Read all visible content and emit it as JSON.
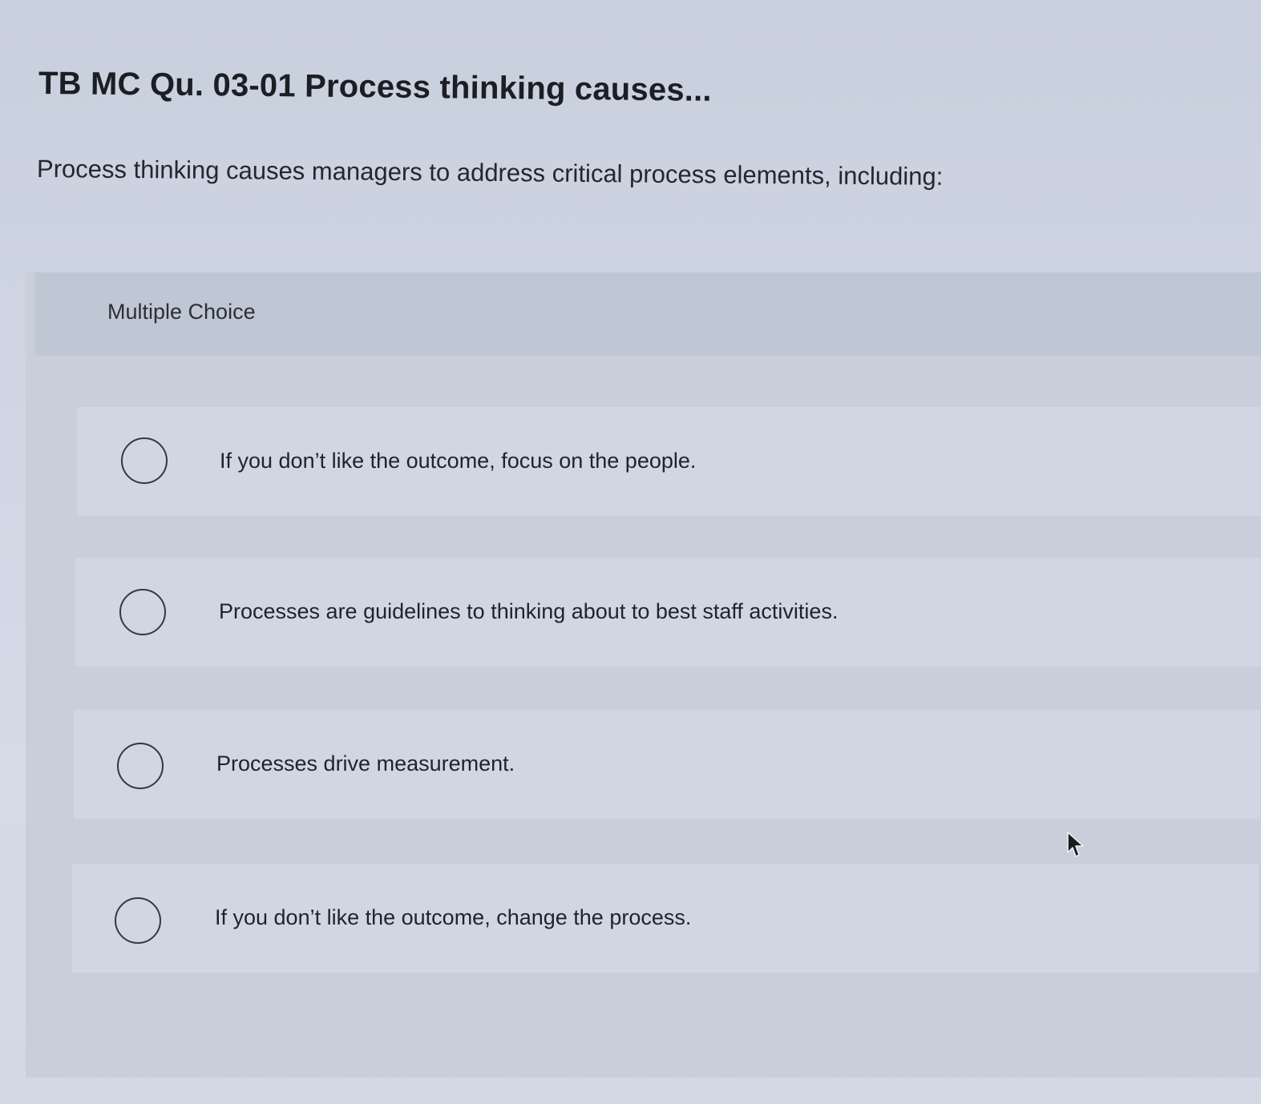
{
  "question": {
    "title": "TB MC Qu. 03-01 Process thinking causes...",
    "prompt": "Process thinking causes managers to address critical process elements, including:"
  },
  "multiple_choice": {
    "label": "Multiple Choice",
    "options": [
      {
        "label": "If you don’t like the outcome, focus on the people.",
        "selected": false
      },
      {
        "label": "Processes are guidelines to thinking about to best staff activities.",
        "selected": false
      },
      {
        "label": "Processes drive measurement.",
        "selected": false
      },
      {
        "label": "If you don’t like the outcome, change the process.",
        "selected": false
      }
    ]
  },
  "icons": {
    "radio": "radio-unselected-icon",
    "cursor": "mouse-pointer-icon"
  },
  "colors": {
    "page_background": "#cfd5e3",
    "panel_background": "#c8cfdb",
    "header_background": "#bfc7d4",
    "option_background": "#d0d7e3",
    "text": "#1f232b"
  }
}
